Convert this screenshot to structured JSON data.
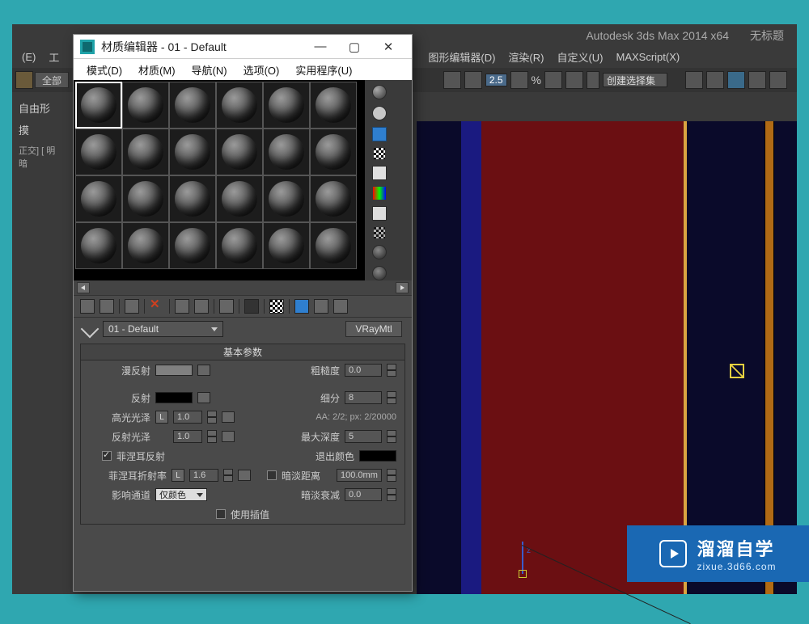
{
  "app": {
    "title": "Autodesk 3ds Max  2014 x64",
    "untitled": "无标题"
  },
  "main_menu": {
    "edit": "(E)",
    "tools": "工",
    "graph": "图形编辑器(D)",
    "render": "渲染(R)",
    "custom": "自定义(U)",
    "script": "MAXScript(X)"
  },
  "toolbar": {
    "all": "全部",
    "free": "自由形",
    "mo": "摸",
    "ortho": "正交] [ 明暗",
    "spinner_x": "2.5",
    "selection_set": "创建选择集"
  },
  "material_editor": {
    "icon_alt": "3ds",
    "title": "材质编辑器 - 01 - Default",
    "win_min": "—",
    "win_max": "▢",
    "win_close": "✕",
    "menu": {
      "mode": "模式(D)",
      "material": "材质(M)",
      "navigate": "导航(N)",
      "options": "选项(O)",
      "utilities": "实用程序(U)"
    },
    "slot_rows": 4,
    "slot_cols": 6,
    "name_field": "01 - Default",
    "type_button": "VRayMtl",
    "rollup_title": "基本参数",
    "params": {
      "diffuse_label": "漫反射",
      "roughness_label": "粗糙度",
      "roughness_value": "0.0",
      "reflect_label": "反射",
      "subdiv_label": "细分",
      "subdiv_value": "8",
      "hilight_label": "高光光泽",
      "hilight_value": "1.0",
      "aa_note": "AA: 2/2; px: 2/20000",
      "reflgloss_label": "反射光泽",
      "reflgloss_value": "1.0",
      "maxdepth_label": "最大深度",
      "maxdepth_value": "5",
      "fresnel_label": "菲涅耳反射",
      "exitcolor_label": "退出颜色",
      "fresnel_ior_label": "菲涅耳折射率",
      "fresnel_ior_value": "1.6",
      "dimdist_label": "暗淡距离",
      "dimdist_value": "100.0mm",
      "affect_label": "影响通道",
      "affect_value": "仅颜色",
      "dimfall_label": "暗淡衰减",
      "dimfall_value": "0.0",
      "interp_label": "使用插值",
      "lock_L": "L"
    }
  },
  "watermark": {
    "brand": "溜溜自学",
    "url": "zixue.3d66.com"
  },
  "gizmo": {
    "z": "z"
  }
}
